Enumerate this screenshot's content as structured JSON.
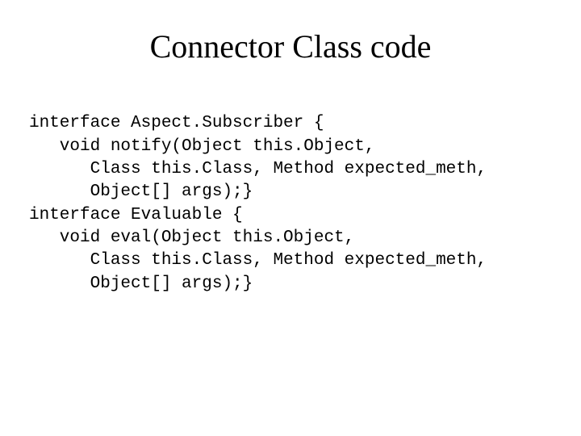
{
  "title": "Connector Class code",
  "code_lines": [
    "interface Aspect.Subscriber {",
    "   void notify(Object this.Object,",
    "      Class this.Class, Method expected_meth,",
    "      Object[] args);}",
    "interface Evaluable {",
    "   void eval(Object this.Object,",
    "      Class this.Class, Method expected_meth,",
    "      Object[] args);}"
  ]
}
